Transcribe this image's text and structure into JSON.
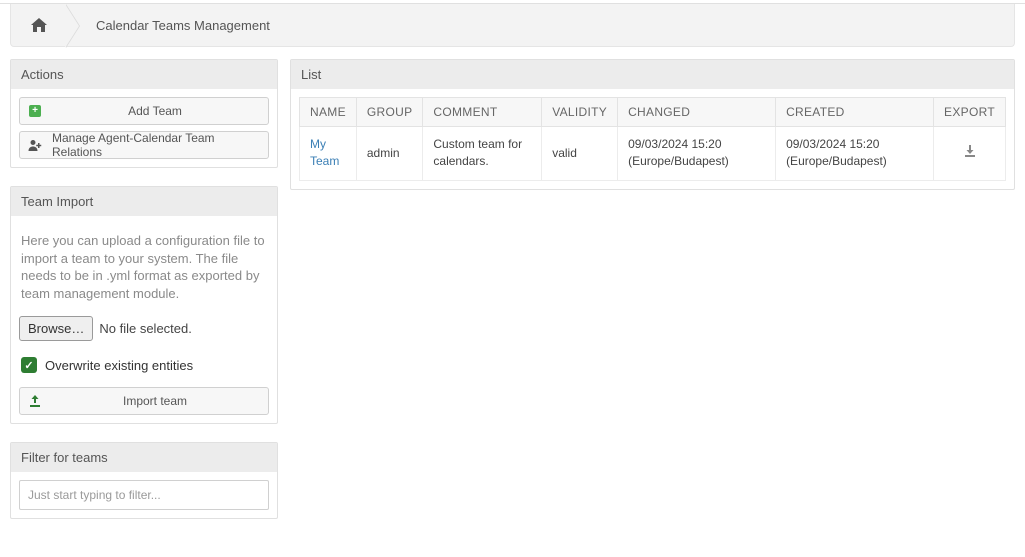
{
  "breadcrumb": {
    "title": "Calendar Teams Management"
  },
  "sidebar": {
    "actions": {
      "title": "Actions",
      "add_team": "Add Team",
      "manage_relations": "Manage Agent-Calendar Team Relations"
    },
    "import": {
      "title": "Team Import",
      "help": "Here you can upload a configuration file to import a team to your system. The file needs to be in .yml format as exported by team management module.",
      "browse_label": "Browse…",
      "file_status": "No file selected.",
      "overwrite_label": "Overwrite existing entities",
      "overwrite_checked": true,
      "import_button": "Import team"
    },
    "filter": {
      "title": "Filter for teams",
      "placeholder": "Just start typing to filter..."
    }
  },
  "list": {
    "title": "List",
    "columns": {
      "name": "NAME",
      "group": "GROUP",
      "comment": "COMMENT",
      "validity": "VALIDITY",
      "changed": "CHANGED",
      "created": "CREATED",
      "export": "EXPORT"
    },
    "rows": [
      {
        "name": "My Team",
        "group": "admin",
        "comment": "Custom team for calendars.",
        "validity": "valid",
        "changed": "09/03/2024 15:20 (Europe/Budapest)",
        "created": "09/03/2024 15:20 (Europe/Budapest)"
      }
    ]
  }
}
